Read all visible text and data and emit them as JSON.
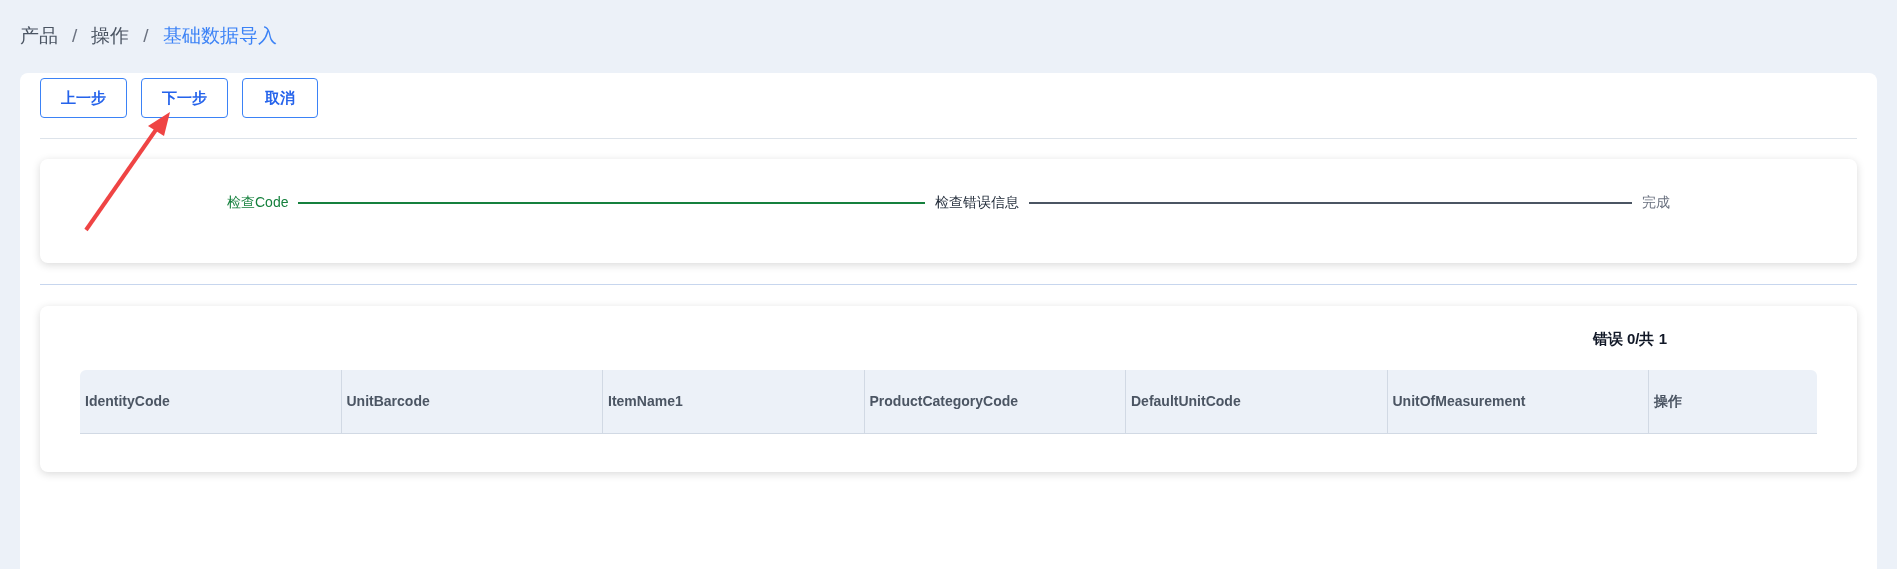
{
  "breadcrumb": [
    {
      "label": "产品",
      "current": false
    },
    {
      "separator": "/",
      "label": "操作",
      "current": false
    },
    {
      "separator": "/",
      "label": "基础数据导入",
      "current": true
    }
  ],
  "buttons": [
    "上一步",
    "下一步",
    "取消"
  ],
  "steps": [
    {
      "label": "检查Code",
      "done": true,
      "current": false
    },
    {
      "label": "检查错误信息",
      "done": false,
      "current": true
    },
    {
      "label": "完成",
      "done": false,
      "current": false
    }
  ],
  "summary": "错误 0/共 1",
  "table": {
    "columns": [
      "IdentityCode",
      "UnitBarcode",
      "ItemName1",
      "ProductCategoryCode",
      "DefaultUnitCode",
      "UnitOfMeasurement",
      "操作"
    ]
  }
}
